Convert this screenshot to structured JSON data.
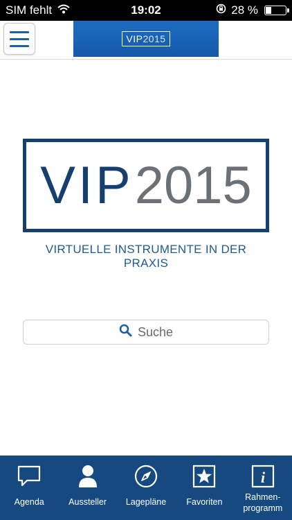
{
  "status_bar": {
    "carrier": "SIM fehlt",
    "time": "19:02",
    "battery_percent": "28 %",
    "battery_level": 0.28
  },
  "header": {
    "banner_vip": "VIP",
    "banner_year": "2015"
  },
  "logo": {
    "vip": "VIP",
    "year": "2015",
    "tagline": "VIRTUELLE INSTRUMENTE IN DER PRAXIS"
  },
  "search": {
    "placeholder": "Suche"
  },
  "tabs": [
    {
      "label": "Agenda",
      "icon": "speech-bubble-icon"
    },
    {
      "label": "Aussteller",
      "icon": "person-icon"
    },
    {
      "label": "Lagepläne",
      "icon": "compass-icon"
    },
    {
      "label": "Favoriten",
      "icon": "star-icon"
    },
    {
      "label": "Rahmen-\nprogramm",
      "icon": "info-icon"
    }
  ],
  "colors": {
    "brand_dark": "#153f6e",
    "tab_bar": "#15497f",
    "banner": "#1d6cc2"
  }
}
